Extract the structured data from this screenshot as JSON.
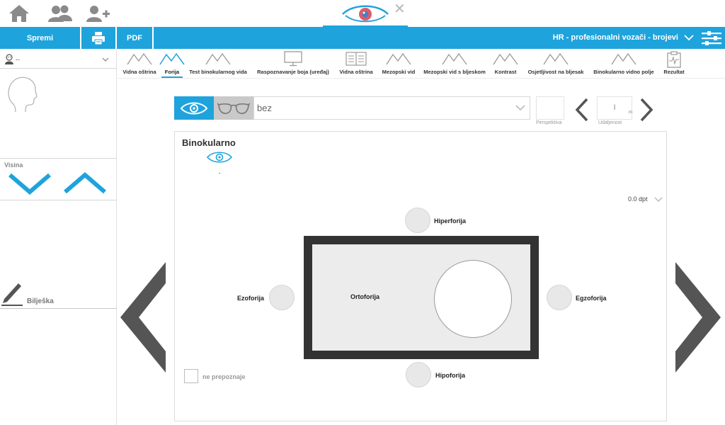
{
  "topbar": {
    "icons": [
      "home-icon",
      "patients-icon",
      "add-patient-icon",
      "eye-logo-icon",
      "close-icon"
    ],
    "close_glyph": "✕"
  },
  "toolbar": {
    "save_label": "Spremi",
    "print_icon": "printer-icon",
    "pdf_label": "PDF",
    "preset_label": "HR - profesionalni vozači - brojevi",
    "accent_color": "#1fa3dc"
  },
  "patient": {
    "name_value": "--"
  },
  "height": {
    "label": "Visina"
  },
  "note": {
    "label": "Bilješka"
  },
  "tabs": [
    {
      "label": "Vidna oštrina",
      "icon": "mountains-icon"
    },
    {
      "label": "Forija",
      "icon": "mountains-icon"
    },
    {
      "label": "Test binokularnog vida",
      "icon": "mountains-icon"
    },
    {
      "label": "Raspoznavanje boja (uređaj)",
      "icon": "monitor-icon"
    },
    {
      "label": "Vidna oštrina",
      "icon": "chart-icon"
    },
    {
      "label": "Mezopski vid",
      "icon": "mountains-icon"
    },
    {
      "label": "Mezopski vid s bljeskom",
      "icon": "mountains-icon"
    },
    {
      "label": "Kontrast",
      "icon": "mountains-icon"
    },
    {
      "label": "Osjetljivost na bljesak",
      "icon": "mountains-icon"
    },
    {
      "label": "Binokularno vidno polje",
      "icon": "mountains-icon"
    },
    {
      "label": "Rezultat",
      "icon": "clipboard-icon"
    }
  ],
  "active_tab": "Forija",
  "controls": {
    "lens_value": "bez",
    "perspective_label": "Perspektiva",
    "distance_value": "I",
    "distance_unit": "m",
    "distance_label": "Udaljenost"
  },
  "test": {
    "title": "Binokularno",
    "dpt_value": "0.0 dpt",
    "hiperforija": "Hiperforija",
    "hipoforija": "Hipoforija",
    "ezoforija": "Ezoforija",
    "egzoforija": "Egzoforija",
    "ortoforija": "Ortoforija",
    "not_recognized": "ne prepoznaje"
  }
}
